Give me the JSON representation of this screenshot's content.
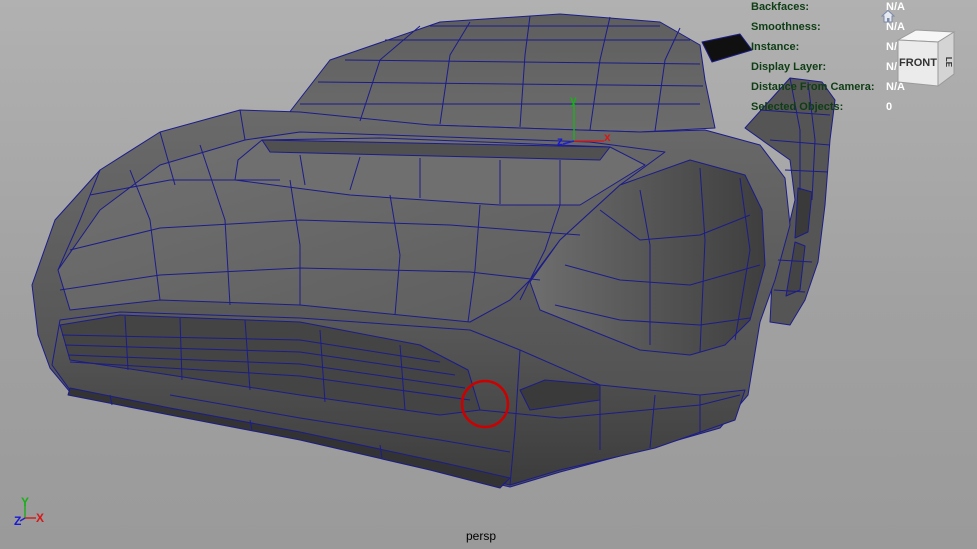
{
  "viewport": {
    "camera_label": "persp",
    "selection_color": "#cc0000",
    "wire_color": "#1c1c8a"
  },
  "hud": {
    "rows": [
      {
        "label": "Backfaces:",
        "value": "N/A"
      },
      {
        "label": "Smoothness:",
        "value": "N/A"
      },
      {
        "label": "Instance:",
        "value": "N/A"
      },
      {
        "label": "Display Layer:",
        "value": "N/A"
      },
      {
        "label": "Distance From Camera:",
        "value": "N/A"
      },
      {
        "label": "Selected Objects:",
        "value": "0"
      }
    ]
  },
  "viewcube": {
    "face_label": "FRONT",
    "side_label": "LE"
  },
  "pivot_axes": {
    "y": "y",
    "x": "x",
    "z": "z"
  },
  "corner_axes": {
    "y": "Y",
    "x": "X",
    "z": "Z"
  },
  "icons": {
    "home": "home-icon",
    "viewcube": "viewcube-icon"
  }
}
